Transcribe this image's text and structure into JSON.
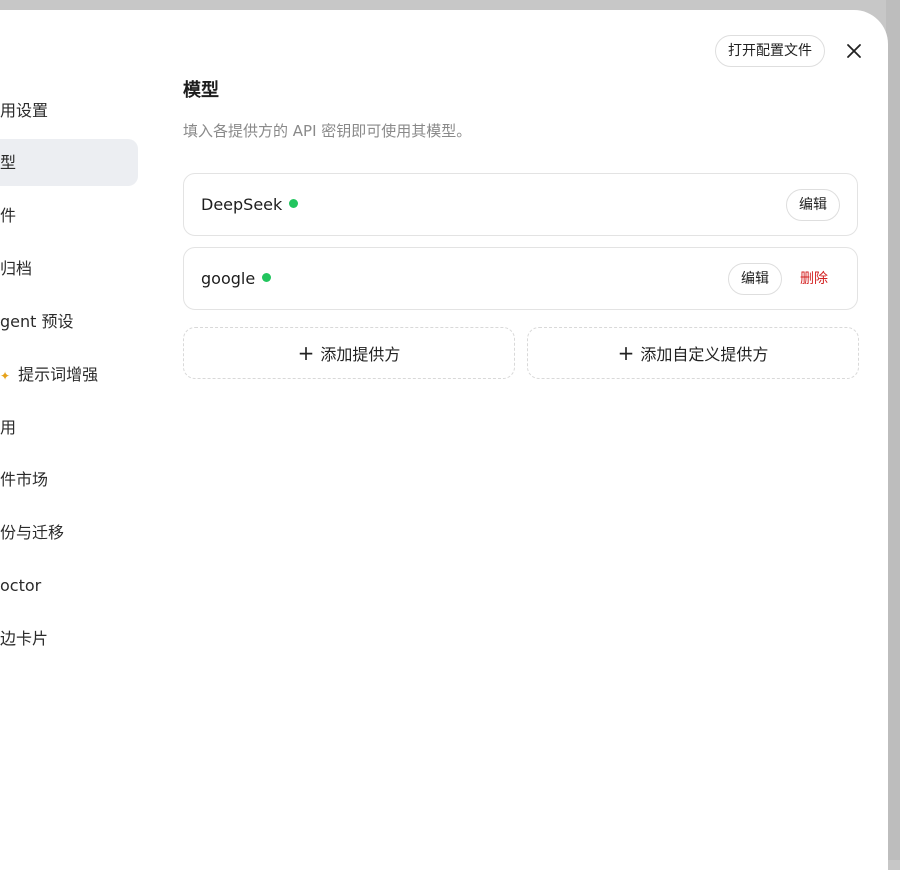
{
  "header": {
    "open_config_label": "打开配置文件"
  },
  "sidebar": {
    "items": [
      {
        "label": "用设置"
      },
      {
        "label": "型",
        "active": true
      },
      {
        "label": "件"
      },
      {
        "label": "归档"
      },
      {
        "label": "gent 预设"
      },
      {
        "label": "提示词增强"
      },
      {
        "label": "用"
      },
      {
        "label": "件市场"
      },
      {
        "label": "份与迁移"
      },
      {
        "label": "octor"
      },
      {
        "label": "边卡片"
      }
    ]
  },
  "main": {
    "title": "模型",
    "subtitle": "填入各提供方的 API 密钥即可使用其模型。",
    "providers": [
      {
        "name": "DeepSeek",
        "status": "active",
        "edit_label": "编辑"
      },
      {
        "name": "google",
        "status": "active",
        "edit_label": "编辑",
        "delete_label": "删除"
      }
    ],
    "add_provider_label": "添加提供方",
    "add_custom_provider_label": "添加自定义提供方"
  },
  "colors": {
    "status_dot": "#22c55e",
    "delete": "#d32020",
    "active_bg": "#eceef2"
  }
}
